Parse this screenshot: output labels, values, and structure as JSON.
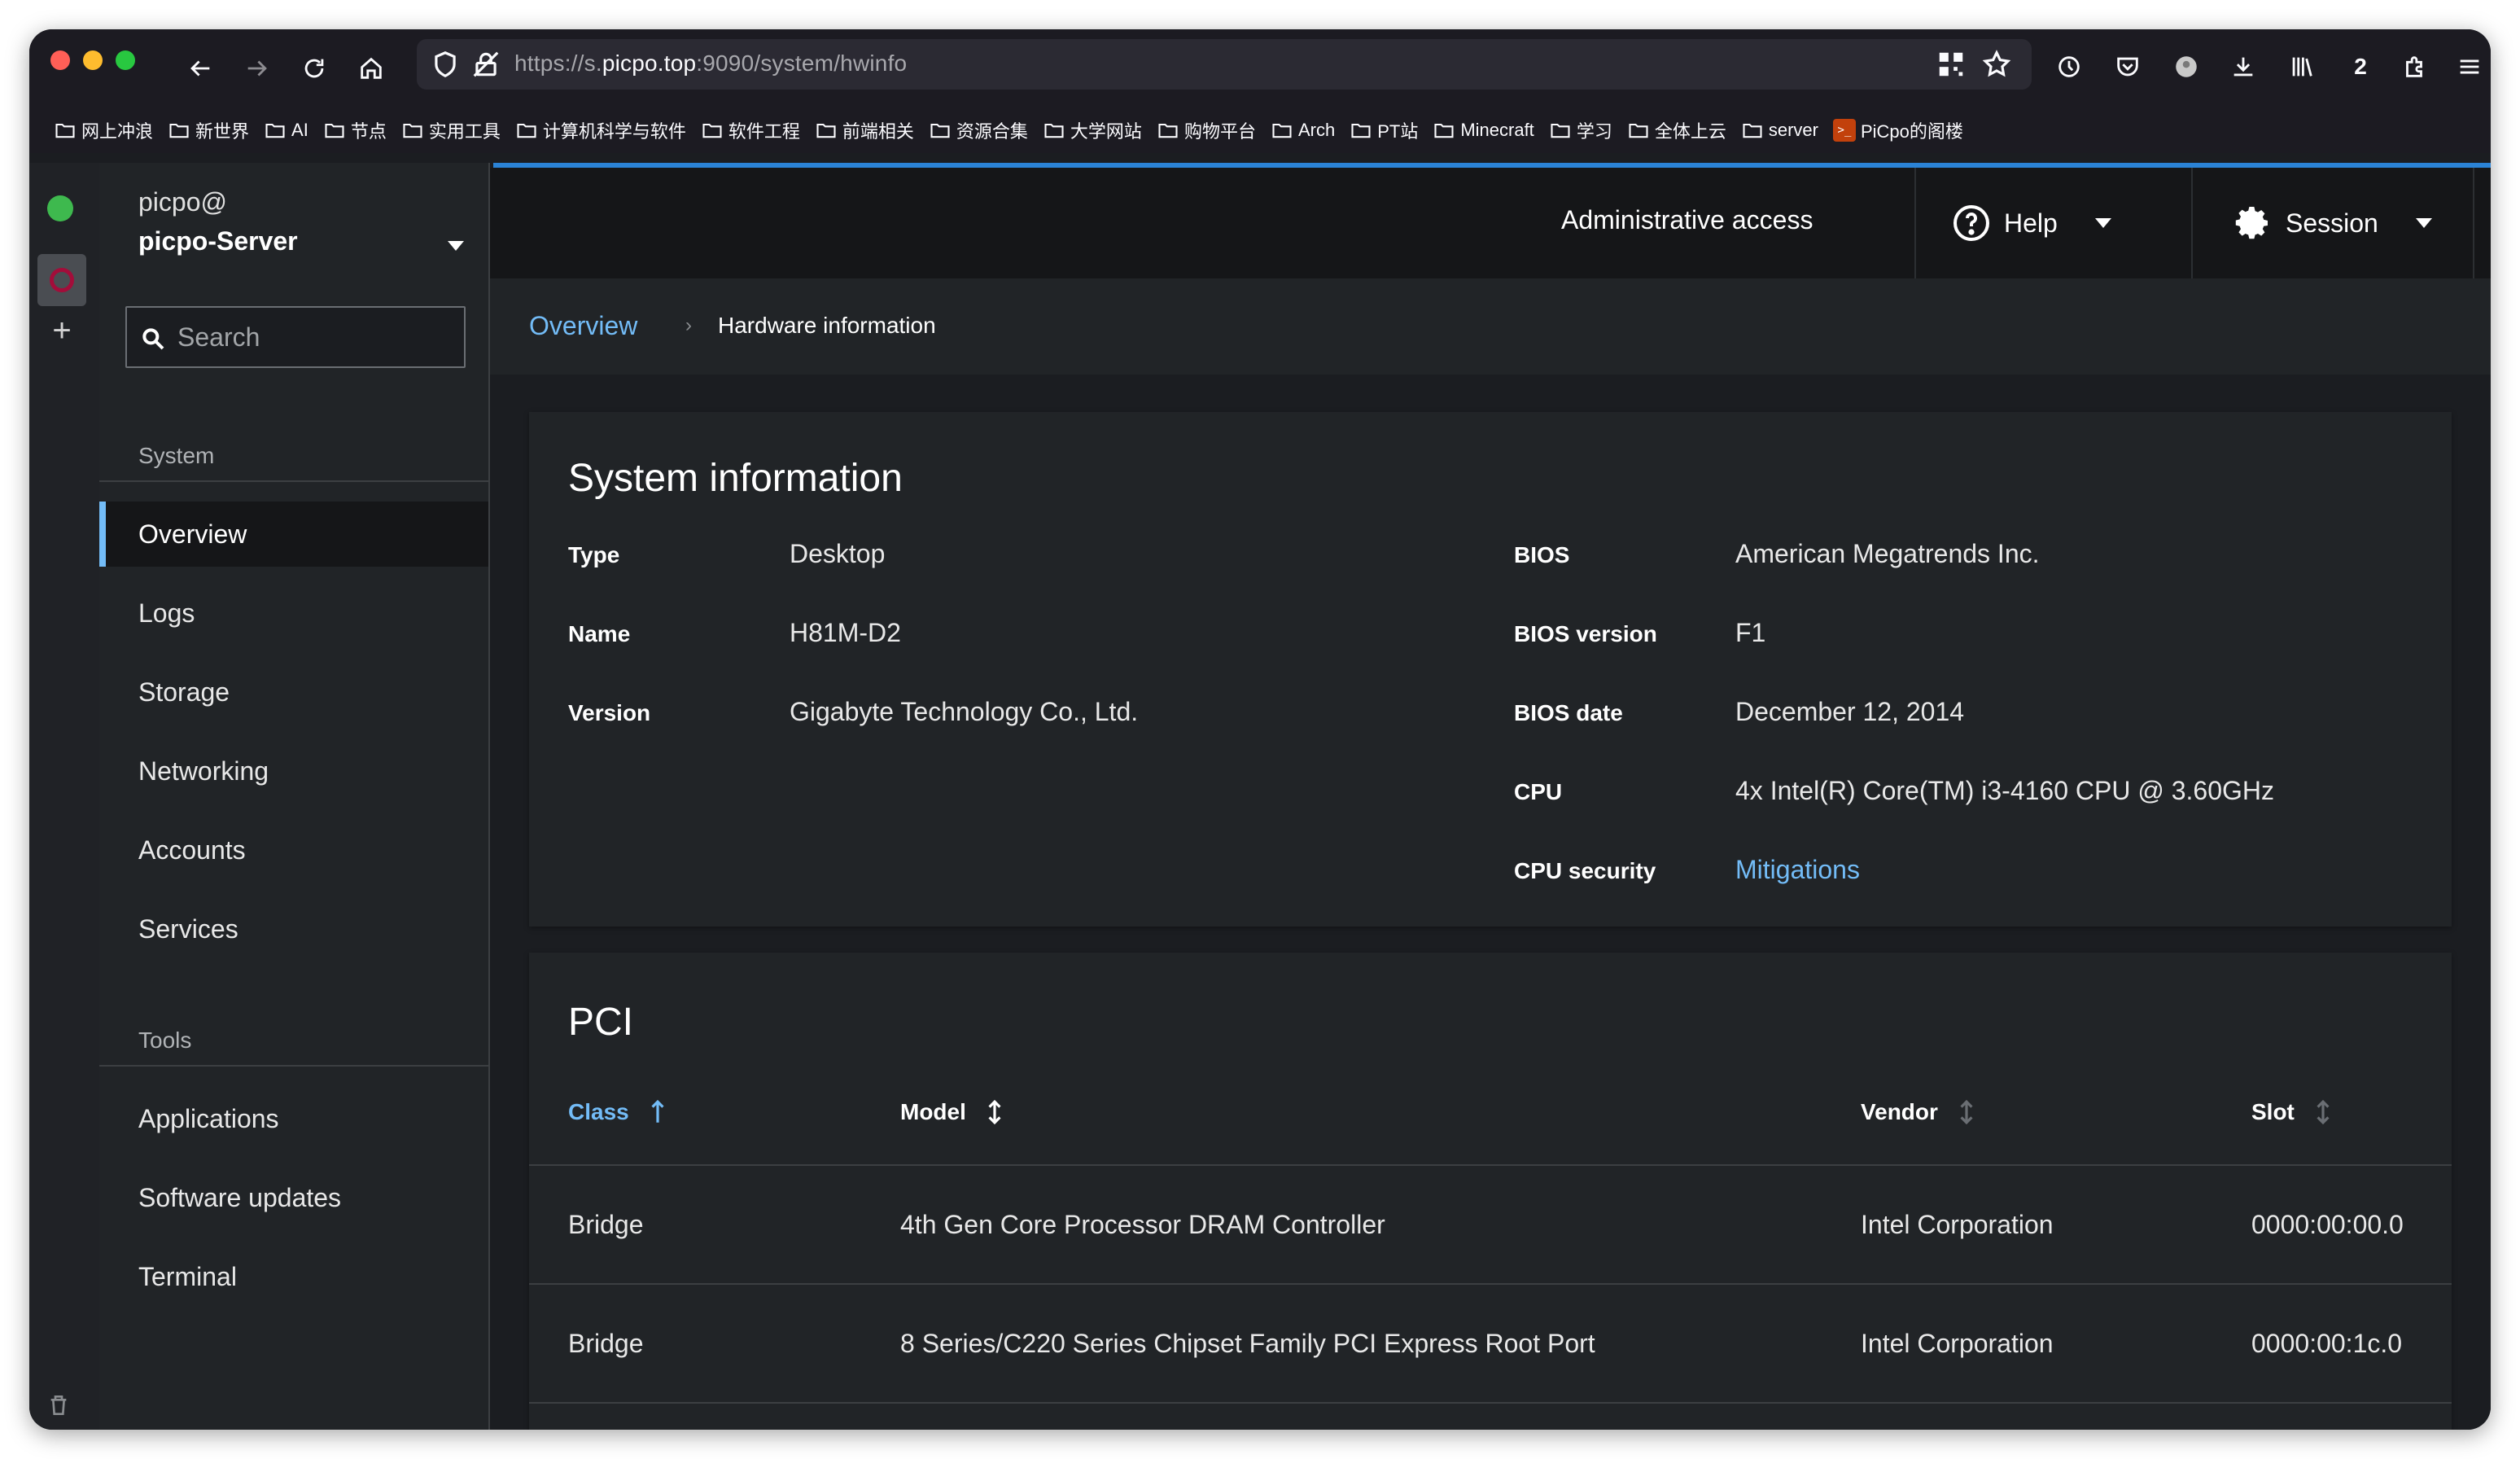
{
  "browser": {
    "url_prefix": "https://s.",
    "url_domain": "picpo.top",
    "url_suffix": ":9090/system/hwinfo",
    "downloads_badge": "2",
    "bookmarks": [
      "网上冲浪",
      "新世界",
      "AI",
      "节点",
      "实用工具",
      "计算机科学与软件",
      "软件工程",
      "前端相关",
      "资源合集",
      "大学网站",
      "购物平台",
      "Arch",
      "PT站",
      "Minecraft",
      "学习",
      "全体上云",
      "server"
    ],
    "bookmark_special": "PiCpo的阁楼"
  },
  "sidebar": {
    "user": "picpo@",
    "host": "picpo-Server",
    "search_placeholder": "Search",
    "system_section": "System",
    "system_items": [
      "Overview",
      "Logs",
      "Storage",
      "Networking",
      "Accounts",
      "Services"
    ],
    "tools_section": "Tools",
    "tools_items": [
      "Applications",
      "Software updates",
      "Terminal"
    ]
  },
  "masthead": {
    "admin": "Administrative access",
    "help": "Help",
    "session": "Session"
  },
  "breadcrumb": {
    "parent": "Overview",
    "current": "Hardware information"
  },
  "system_info": {
    "title": "System information",
    "left": [
      {
        "label": "Type",
        "value": "Desktop"
      },
      {
        "label": "Name",
        "value": "H81M-D2"
      },
      {
        "label": "Version",
        "value": "Gigabyte Technology Co., Ltd."
      }
    ],
    "right": [
      {
        "label": "BIOS",
        "value": "American Megatrends Inc."
      },
      {
        "label": "BIOS version",
        "value": "F1"
      },
      {
        "label": "BIOS date",
        "value": "December 12, 2014"
      },
      {
        "label": "CPU",
        "value": "4x Intel(R) Core(TM) i3-4160 CPU @ 3.60GHz"
      },
      {
        "label": "CPU security",
        "value": "Mitigations"
      }
    ]
  },
  "pci": {
    "title": "PCI",
    "columns": [
      "Class",
      "Model",
      "Vendor",
      "Slot"
    ],
    "rows": [
      {
        "class": "Bridge",
        "model": "4th Gen Core Processor DRAM Controller",
        "vendor": "Intel Corporation",
        "slot": "0000:00:00.0"
      },
      {
        "class": "Bridge",
        "model": "8 Series/C220 Series Chipset Family PCI Express Root Port",
        "vendor": "Intel Corporation",
        "slot": "0000:00:1c.0"
      }
    ]
  },
  "colors": {
    "accent": "#73bcf7",
    "host_status": "#3eb94e",
    "traffic_close": "#ff5f57",
    "traffic_min": "#febc2e",
    "traffic_max": "#28c840"
  }
}
